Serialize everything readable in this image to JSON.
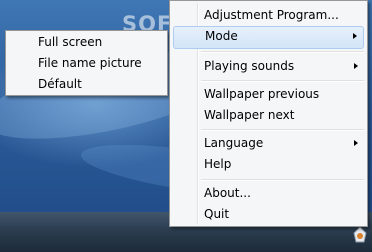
{
  "watermark": "SOFTPEDIA",
  "context_menu": {
    "items": [
      {
        "label": "Adjustment Program..."
      },
      {
        "label": "Mode"
      },
      {
        "label": "Playing sounds"
      },
      {
        "label": "Wallpaper previous"
      },
      {
        "label": "Wallpaper next"
      },
      {
        "label": "Language"
      },
      {
        "label": "Help"
      },
      {
        "label": "About..."
      },
      {
        "label": "Quit"
      }
    ]
  },
  "mode_submenu": {
    "items": [
      {
        "label": "Full screen"
      },
      {
        "label": "File name picture"
      },
      {
        "label": "Défault"
      }
    ]
  },
  "tray": {
    "icon": "app-tray-icon"
  },
  "colors": {
    "highlight": "#d3e5f8",
    "menu_bg": "#f5f6f7",
    "taskbar": "#2d3f52"
  }
}
